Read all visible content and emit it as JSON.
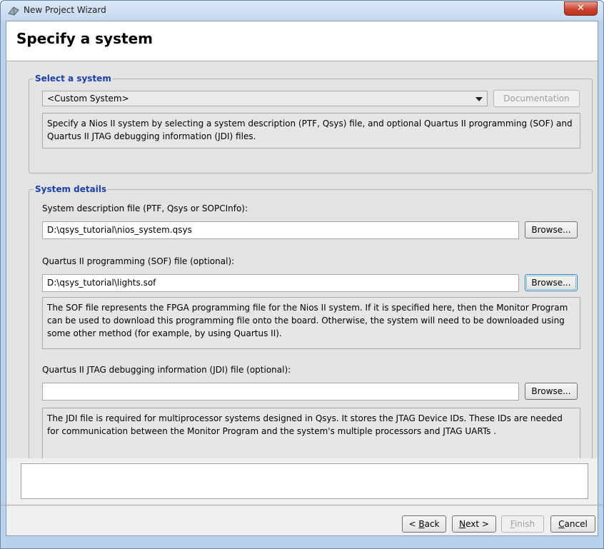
{
  "window": {
    "title": "New Project Wizard",
    "close_glyph": "✕"
  },
  "header": {
    "title": "Specify a system"
  },
  "select_system": {
    "legend": "Select a system",
    "combo_value": "<Custom System>",
    "documentation_label": "Documentation",
    "description": "Specify a Nios II system by selecting a system description (PTF, Qsys) file, and optional Quartus II programming (SOF) and Quartus II JTAG debugging information (JDI) files."
  },
  "system_details": {
    "legend": "System details",
    "sysdesc_label": "System description file (PTF, Qsys or SOPCInfo):",
    "sysdesc_value": "D:\\qsys_tutorial\\nios_system.qsys",
    "sof_label": "Quartus II programming (SOF) file (optional):",
    "sof_value": "D:\\qsys_tutorial\\lights.sof",
    "sof_description": "The SOF file represents the FPGA programming file for the Nios II system. If it is specified here, then the Monitor Program can be used to download this programming file onto the board. Otherwise, the system will need to be downloaded using some other method (for example, by using Quartus II).",
    "jdi_label": "Quartus II JTAG debugging information (JDI) file (optional):",
    "jdi_value": "",
    "jdi_description": "The JDI file is required for multiprocessor systems designed in Qsys. It stores the JTAG Device IDs. These IDs are needed for communication between the Monitor Program and the system's multiple processors and JTAG UARTs .",
    "browse_label": "Browse..."
  },
  "footer": {
    "back": {
      "pre": "< ",
      "key": "B",
      "post": "ack"
    },
    "next": {
      "key": "N",
      "post": "ext >"
    },
    "finish": {
      "key": "F",
      "post": "inish"
    },
    "cancel": {
      "key": "C",
      "post": "ancel"
    }
  },
  "icons": {
    "title": "wizard-icon",
    "dropdown": "chevron-down-icon"
  },
  "colors": {
    "legend": "#1c3fa8",
    "title_bar": "#c5d8ee",
    "close": "#c9432f"
  }
}
